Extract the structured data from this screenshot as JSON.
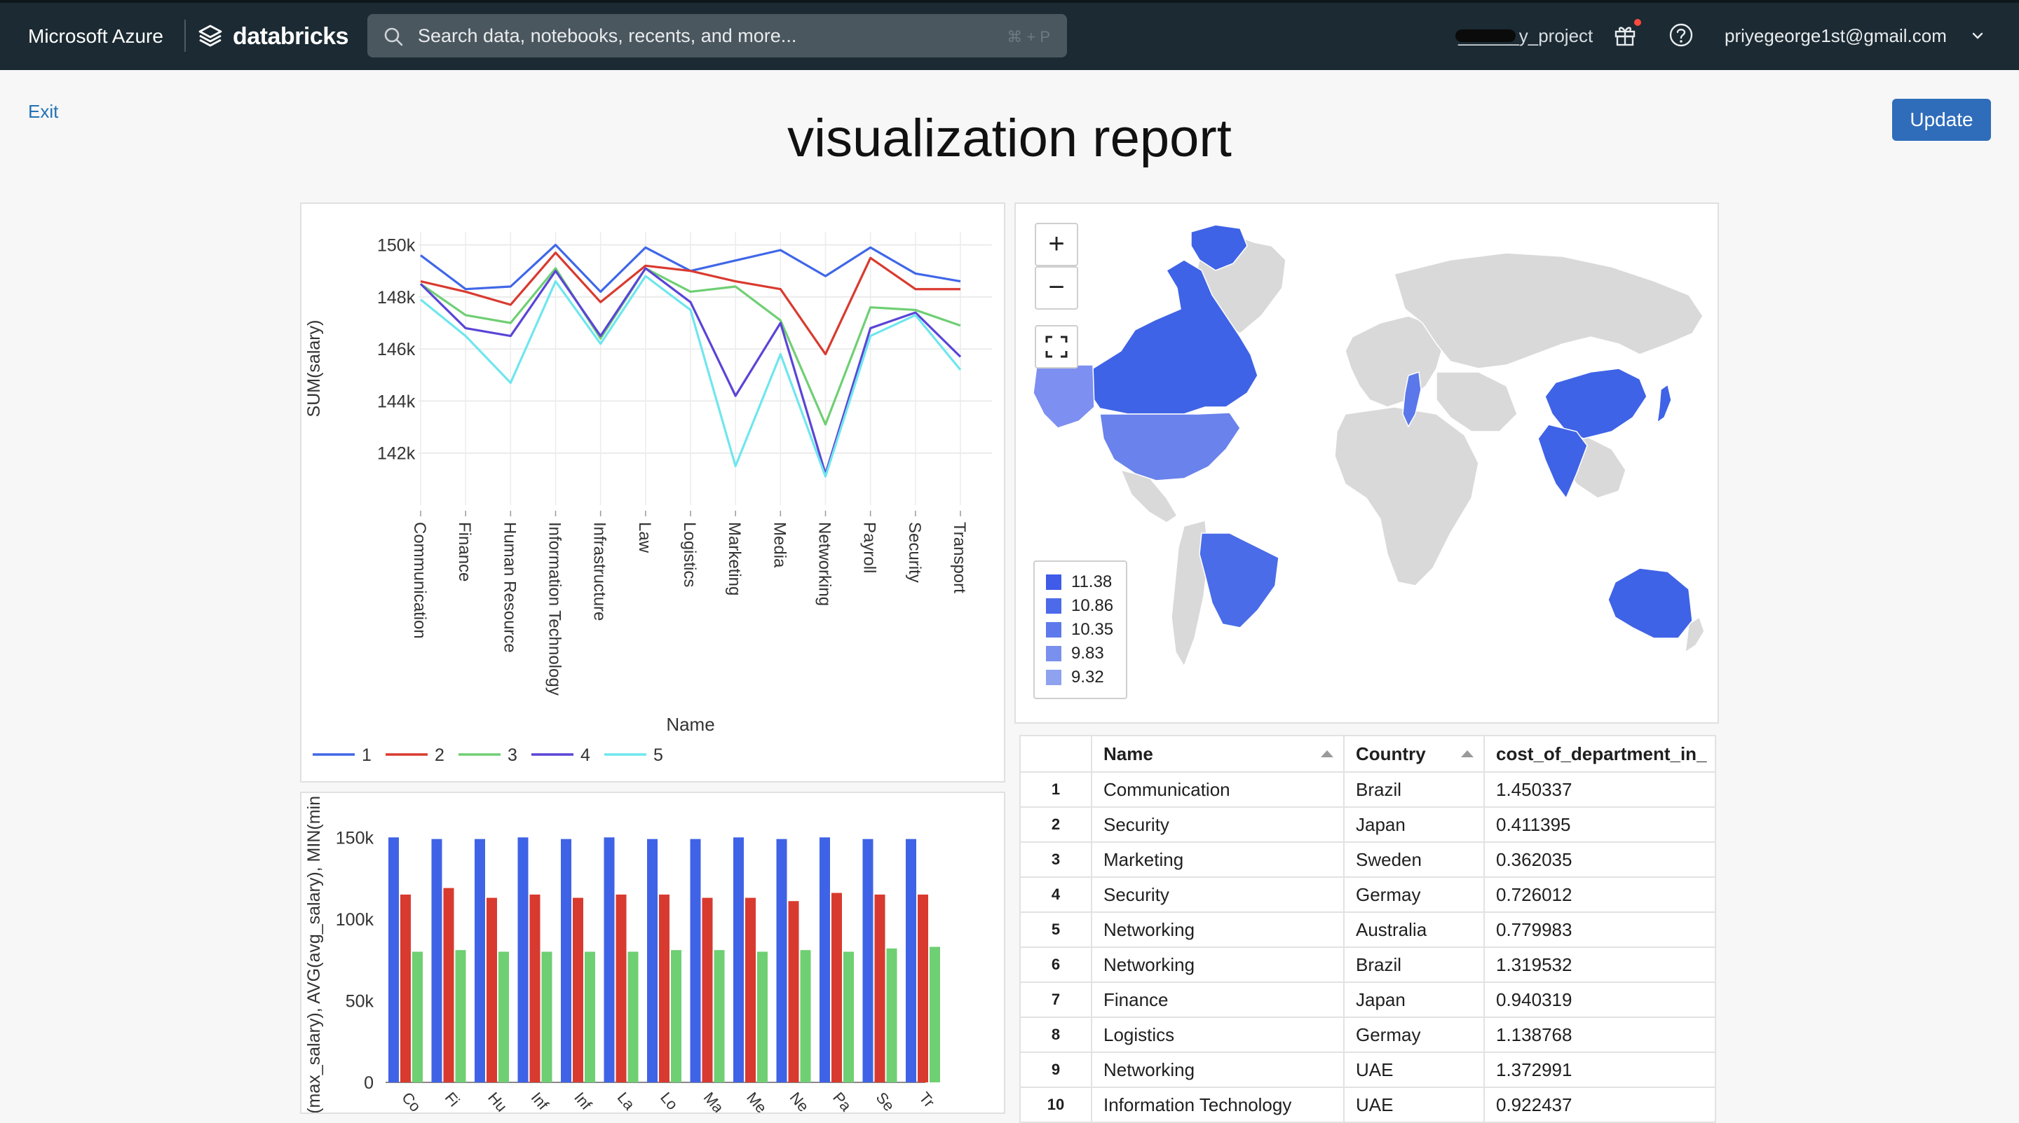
{
  "topbar": {
    "brand_left": "Microsoft Azure",
    "brand_right": "databricks",
    "search_placeholder": "Search data, notebooks, recents, and more...",
    "search_shortcut": "⌘ + P",
    "workspace": "______y_project",
    "user": "priyegeorge1st@gmail.com",
    "icons": [
      "databricks-logo-icon",
      "search-icon",
      "gift-icon",
      "help-icon",
      "chevron-down-icon"
    ]
  },
  "page": {
    "exit_label": "Exit",
    "title": "visualization report",
    "update_label": "Update"
  },
  "colors": {
    "topbar": "#1b2a33",
    "accent": "#2f6cba",
    "series": [
      "#3f67e8",
      "#d93a2f",
      "#6fcf73",
      "#5a45d6",
      "#6fe6ee"
    ],
    "map_fill": "#3f63e6",
    "map_base": "#d9d9d9"
  },
  "chart_data": [
    {
      "type": "line",
      "title": "",
      "xlabel": "Name",
      "ylabel": "SUM(salary)",
      "categories": [
        "Communication",
        "Finance",
        "Human Resource",
        "Information Technology",
        "Infrastructure",
        "Law",
        "Logistics",
        "Marketing",
        "Media",
        "Networking",
        "Payroll",
        "Security",
        "Transport"
      ],
      "ylim": [
        140000,
        150500
      ],
      "yticks": [
        142000,
        144000,
        146000,
        148000,
        150000
      ],
      "ytick_labels": [
        "142k",
        "144k",
        "146k",
        "148k",
        "150k"
      ],
      "grid": true,
      "legend": "bottom-left",
      "series": [
        {
          "name": "1",
          "values": [
            149600,
            148300,
            148400,
            150000,
            148200,
            149900,
            149000,
            149400,
            149800,
            148800,
            149900,
            148900,
            148600
          ]
        },
        {
          "name": "2",
          "values": [
            148600,
            148200,
            147700,
            149700,
            147800,
            149200,
            149000,
            148600,
            148300,
            145800,
            149500,
            148300,
            148300
          ]
        },
        {
          "name": "3",
          "values": [
            148500,
            147300,
            147000,
            149100,
            146400,
            149100,
            148200,
            148400,
            147100,
            143100,
            147600,
            147500,
            146900
          ]
        },
        {
          "name": "4",
          "values": [
            148500,
            146800,
            146500,
            149000,
            146500,
            149100,
            147800,
            144200,
            147000,
            141200,
            146800,
            147400,
            145700
          ]
        },
        {
          "name": "5",
          "values": [
            147900,
            146500,
            144700,
            148600,
            146200,
            148800,
            147500,
            141500,
            145800,
            141100,
            146500,
            147300,
            145200
          ]
        }
      ]
    },
    {
      "type": "bar",
      "title": "",
      "ylabel": "MAX(max_salary), AVG(avg_salary), MIN(min",
      "ylim": [
        0,
        160000
      ],
      "yticks": [
        0,
        50000,
        100000,
        150000
      ],
      "ytick_labels": [
        "0",
        "50k",
        "100k",
        "150k"
      ],
      "categories": [
        "Communication",
        "Finance",
        "Human Resource",
        "Information Technology",
        "Infrastructure",
        "Law",
        "Logistics",
        "Marketing",
        "Media",
        "Networking",
        "Payroll",
        "Security",
        "Transport"
      ],
      "tick_labels": [
        "Co",
        "Fi",
        "Hu",
        "Inf",
        "Inf",
        "La",
        "Lo",
        "Ma",
        "Me",
        "Ne",
        "Pa",
        "Se",
        "Tr"
      ],
      "series": [
        {
          "values": [
            150000,
            149000,
            149000,
            150000,
            149000,
            150000,
            149000,
            149000,
            150000,
            149000,
            150000,
            149000,
            149000
          ]
        },
        {
          "values": [
            115000,
            119000,
            113000,
            115000,
            113000,
            115000,
            115000,
            113000,
            113000,
            111000,
            116000,
            115000,
            115000
          ]
        },
        {
          "values": [
            80000,
            81000,
            80000,
            80000,
            80000,
            80000,
            81000,
            81000,
            80000,
            81000,
            80000,
            82000,
            83000
          ]
        }
      ]
    },
    {
      "type": "map",
      "legend_values": [
        "11.38",
        "10.86",
        "10.35",
        "9.83",
        "9.32"
      ],
      "legend_colors": [
        "#3f5be8",
        "#4d6aea",
        "#5d79ec",
        "#7a90ee",
        "#8fa2f0"
      ],
      "highlighted_regions": [
        "Canada",
        "United States",
        "Alaska",
        "Greenland",
        "Brazil",
        "Sweden",
        "China",
        "India",
        "Japan",
        "Australia"
      ]
    }
  ],
  "table": {
    "columns": [
      "",
      "Name",
      "Country",
      "cost_of_department_in_"
    ],
    "rows": [
      [
        "1",
        "Communication",
        "Brazil",
        "1.450337"
      ],
      [
        "2",
        "Security",
        "Japan",
        "0.411395"
      ],
      [
        "3",
        "Marketing",
        "Sweden",
        "0.362035"
      ],
      [
        "4",
        "Security",
        "Germay",
        "0.726012"
      ],
      [
        "5",
        "Networking",
        "Australia",
        "0.779983"
      ],
      [
        "6",
        "Networking",
        "Brazil",
        "1.319532"
      ],
      [
        "7",
        "Finance",
        "Japan",
        "0.940319"
      ],
      [
        "8",
        "Logistics",
        "Germay",
        "1.138768"
      ],
      [
        "9",
        "Networking",
        "UAE",
        "1.372991"
      ],
      [
        "10",
        "Information Technology",
        "UAE",
        "0.922437"
      ]
    ]
  }
}
